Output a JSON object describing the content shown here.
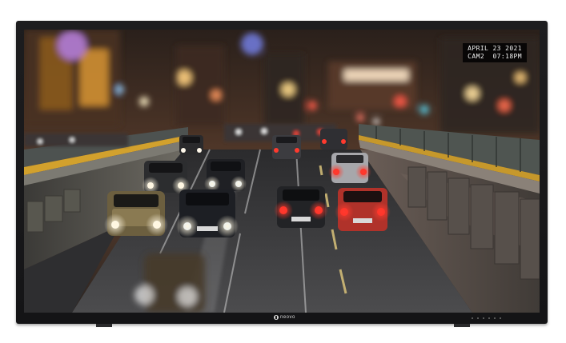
{
  "osd": {
    "date": "APRIL 23 2021",
    "time_line": "CAM2  07:18PM"
  },
  "brand": {
    "name": "neovo",
    "icon": "neovo-logo-icon"
  },
  "colors": {
    "bezel": "#1d1d1f",
    "osd_background": "#000000",
    "osd_text": "#f1f1f1"
  }
}
